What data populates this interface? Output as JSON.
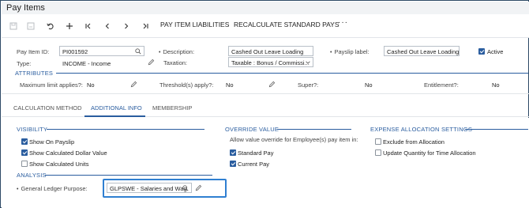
{
  "window": {
    "title": "Pay Items"
  },
  "toolbar": {
    "actions": [
      "PAY ITEM LIABILITIES",
      "RECALCULATE STANDARD PAYS"
    ],
    "more": "···"
  },
  "form": {
    "pay_item_id_label": "Pay Item ID:",
    "pay_item_id_value": "PI001592",
    "type_label": "Type:",
    "type_value": "INCOME - Income",
    "description_label": "Description:",
    "description_value": "Cashed Out Leave Loading",
    "taxation_label": "Taxation:",
    "taxation_value": "Taxable : Bonus / Commissi...",
    "payslip_label_label": "Payslip label:",
    "payslip_label_value": "Cashed Out Leave Loading",
    "active_label": "Active",
    "active_checked": true
  },
  "attributes": {
    "title": "ATTRIBUTES",
    "items": [
      {
        "label": "Maximum limit applies?:",
        "value": "No"
      },
      {
        "label": "Threshold(s) apply?:",
        "value": "No"
      },
      {
        "label": "Super?:",
        "value": "No"
      },
      {
        "label": "Entitlement?:",
        "value": "No"
      }
    ]
  },
  "tabs": [
    "CALCULATION METHOD",
    "ADDITIONAL INFO",
    "MEMBERSHIP"
  ],
  "active_tab": "ADDITIONAL INFO",
  "visibility": {
    "title": "VISIBILITY",
    "options": [
      {
        "label": "Show On Payslip",
        "checked": true
      },
      {
        "label": "Show Calculated Dollar Value",
        "checked": true
      },
      {
        "label": "Show Calculated Units",
        "checked": false
      }
    ]
  },
  "override": {
    "title": "OVERRIDE VALUE",
    "description": "Allow value override for Employee(s) pay item in:",
    "options": [
      {
        "label": "Standard Pay",
        "checked": true
      },
      {
        "label": "Current Pay",
        "checked": true
      }
    ]
  },
  "expense": {
    "title": "EXPENSE ALLOCATION SETTINGS",
    "options": [
      {
        "label": "Exclude from Allocation",
        "checked": false
      },
      {
        "label": "Update Quantity for Time Allocation",
        "checked": false
      }
    ]
  },
  "analysis": {
    "title": "ANALYSIS",
    "gl_label": "General Ledger Purpose:",
    "gl_value": "GLPSWE - Salaries and Wag"
  },
  "colors": {
    "accent": "#2a5d9f",
    "highlight_border": "#2f7fd1",
    "checkbox_checked": "#2a5d9f"
  },
  "icons": {
    "toolbar": [
      "save-icon",
      "save-close-icon",
      "undo-icon",
      "add-icon",
      "first-icon",
      "previous-icon",
      "next-icon",
      "last-icon"
    ],
    "lookup": "search-icon",
    "edit": "pencil-icon",
    "dropdown": "chevron-down-icon"
  }
}
